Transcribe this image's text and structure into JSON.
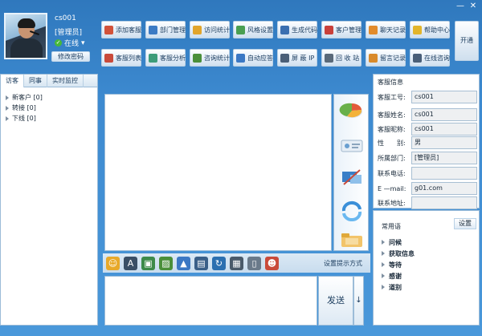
{
  "window": {
    "minimize": "—",
    "close": "✕"
  },
  "user": {
    "id": "cs001",
    "role": "[管理员]",
    "status": "在线",
    "change_password": "修改密码"
  },
  "toolbar_row1": [
    {
      "label": "添加客服",
      "icon": "add-agent-icon",
      "color": "#d2523a"
    },
    {
      "label": "部门管理",
      "icon": "department-icon",
      "color": "#3c7bc4"
    },
    {
      "label": "访问统计",
      "icon": "visit-stats-icon",
      "color": "#e2a52b"
    },
    {
      "label": "风格设置",
      "icon": "style-icon",
      "color": "#4a9f52"
    },
    {
      "label": "生成代码",
      "icon": "code-icon",
      "color": "#3b6fb0"
    },
    {
      "label": "客户管理",
      "icon": "customer-icon",
      "color": "#c9403a"
    },
    {
      "label": "聊天记录",
      "icon": "chat-log-icon",
      "color": "#e28b2b"
    },
    {
      "label": "帮助中心",
      "icon": "help-icon",
      "color": "#e2b52b"
    }
  ],
  "toolbar_row2": [
    {
      "label": "客服列表",
      "icon": "agent-list-icon",
      "color": "#c94a3a"
    },
    {
      "label": "客服分析",
      "icon": "analysis-icon",
      "color": "#3c9c7a"
    },
    {
      "label": "咨询统计",
      "icon": "consult-stats-icon",
      "color": "#4a8f3a"
    },
    {
      "label": "自动应答",
      "icon": "auto-reply-icon",
      "color": "#3b78c4"
    },
    {
      "label": "屏 蔽 IP",
      "icon": "block-ip-icon",
      "color": "#4a5f78"
    },
    {
      "label": "回 收 站",
      "icon": "recycle-bin-icon",
      "color": "#5a6a7a"
    },
    {
      "label": "留言记录",
      "icon": "message-icon",
      "color": "#d98a2a"
    },
    {
      "label": "在线咨询",
      "icon": "online-consult-icon",
      "color": "#4a5f78"
    }
  ],
  "open_button": "开通",
  "left_tabs": [
    "访客",
    "同事",
    "实时监控"
  ],
  "visitor_tree": [
    "新客户 [0]",
    "转接 [0]",
    "下线 [0]"
  ],
  "input_toolbar": {
    "icons": [
      {
        "name": "emoji-icon",
        "glyph": "☺",
        "color": "#e8a92a"
      },
      {
        "name": "font-icon",
        "glyph": "A",
        "color": "#3a4f66"
      },
      {
        "name": "screenshot-icon",
        "glyph": "▣",
        "color": "#3c8a4a"
      },
      {
        "name": "image-icon",
        "glyph": "▨",
        "color": "#4a8f3a"
      },
      {
        "name": "picture-icon",
        "glyph": "▲",
        "color": "#3b78c4"
      },
      {
        "name": "save-icon",
        "glyph": "▤",
        "color": "#3a5f88"
      },
      {
        "name": "transfer-icon",
        "glyph": "↻",
        "color": "#2b6fb0"
      },
      {
        "name": "card-icon",
        "glyph": "▦",
        "color": "#4a5a6a"
      },
      {
        "name": "trash-icon",
        "glyph": "▯",
        "color": "#6a7a8a"
      },
      {
        "name": "invite-icon",
        "glyph": "☻",
        "color": "#c94a3a"
      }
    ],
    "tip_settings": "设置提示方式"
  },
  "send_button": "发送",
  "send_menu": "↓",
  "agent_info": {
    "title": "客服信息",
    "fields": [
      {
        "label": "客服工号:",
        "value": "cs001"
      },
      {
        "label": "客服姓名:",
        "value": "cs001"
      },
      {
        "label": "客服昵称:",
        "value": "cs001"
      },
      {
        "label": "性　　别:",
        "value": "男"
      },
      {
        "label": "所属部门:",
        "value": "[管理员]"
      },
      {
        "label": "联系电话:",
        "value": ""
      },
      {
        "label": "E —mail:",
        "value": "g01.com"
      },
      {
        "label": "联系地址:",
        "value": ""
      }
    ]
  },
  "phrases": {
    "title": "常用语",
    "settings": "设置",
    "items": [
      "问候",
      "获取信息",
      "等待",
      "感谢",
      "道别"
    ]
  }
}
